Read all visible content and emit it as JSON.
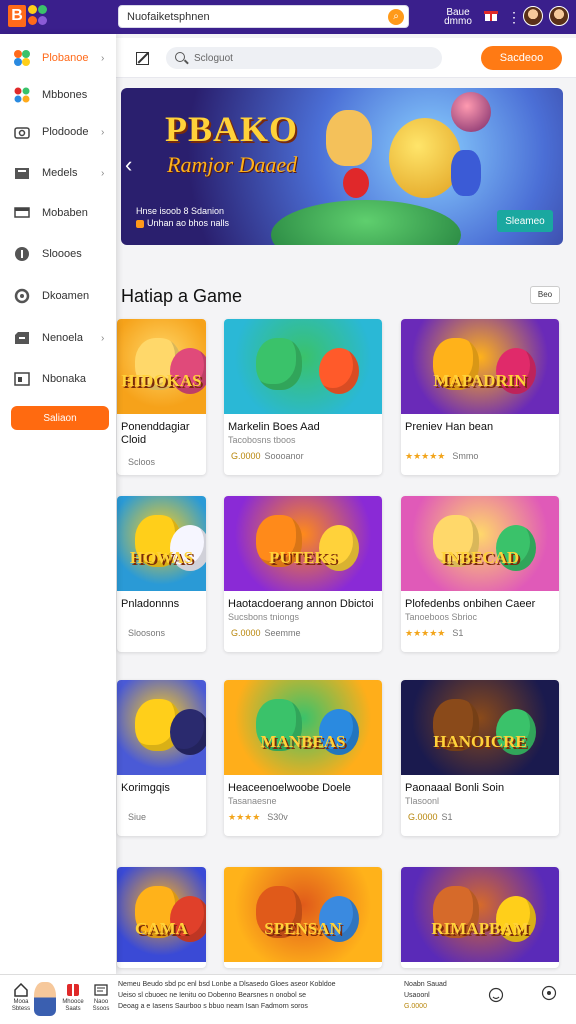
{
  "topbar": {
    "logo_letter": "B",
    "search_value": "Nuofaiketsphnen",
    "label": "Baue dmmo",
    "icons": [
      "gift-icon",
      "more-vertical-icon",
      "avatar",
      "avatar"
    ]
  },
  "sidebar": {
    "items": [
      {
        "label": "Plobanoe",
        "icon": "colorful-blocks-icon",
        "chevron": true,
        "active": true
      },
      {
        "label": "Mbbones",
        "icon": "dots-icon",
        "chevron": false,
        "active": false
      },
      {
        "label": "Plodoode",
        "icon": "camera-icon",
        "chevron": true,
        "active": false
      },
      {
        "label": "Medels",
        "icon": "box-icon",
        "chevron": true,
        "active": false
      },
      {
        "label": "Mobaben",
        "icon": "monitor-icon",
        "chevron": false,
        "active": false
      },
      {
        "label": "Sloooes",
        "icon": "info-icon",
        "chevron": false,
        "active": false
      },
      {
        "label": "Dkoamen",
        "icon": "settings-icon",
        "chevron": false,
        "active": false
      },
      {
        "label": "Nenoela",
        "icon": "store-icon",
        "chevron": true,
        "active": false
      },
      {
        "label": "Nbonaka",
        "icon": "window-icon",
        "chevron": false,
        "active": false
      }
    ],
    "button_label": "Saliaon"
  },
  "subbar": {
    "search_placeholder": "Scloguot",
    "button_label": "Sacdeoo"
  },
  "banner": {
    "title": "PBAKO",
    "subtitle": "Ramjor Daaed",
    "caption1": "Hnse isoob 8 Sdanion",
    "caption2": "Unhan ao bhos nalls",
    "button_label": "Sleameo"
  },
  "section": {
    "title": "Hatiap a Game",
    "select_value": "Beo"
  },
  "cards": [
    {
      "image_text": "HIDOKAS",
      "title": "Ponenddagiar",
      "title2": "Cloid",
      "sub": "",
      "meta_stars": "",
      "meta_price": "",
      "meta_extra": "Scloos"
    },
    {
      "image_text": "",
      "title": "Markelin Boes Aad",
      "title2": "",
      "sub": "Tacobosns tboos",
      "meta_stars": "",
      "meta_price": "G.0000",
      "meta_extra": "Soooanor"
    },
    {
      "image_text": "MAPADRIN",
      "title": "Preniev Han bean",
      "title2": "",
      "sub": "",
      "meta_stars": "★★★★★",
      "meta_price": "",
      "meta_extra": "Smmo"
    },
    {
      "image_text": "HOWAS",
      "title": "Pnladonnns",
      "title2": "",
      "sub": "",
      "meta_stars": "",
      "meta_price": "",
      "meta_extra": "Sloosons"
    },
    {
      "image_text": "PUTEKS",
      "title": "Haotacdoerang annon Dbictoi",
      "title2": "",
      "sub": "Sucsbons tniongs",
      "meta_stars": "",
      "meta_price": "G.0000",
      "meta_extra": "Seemme"
    },
    {
      "image_text": "INBECAD",
      "title": "Plofedenbs onbihen Caeer",
      "title2": "",
      "sub": "Tanoeboos Sbrioc",
      "meta_stars": "★★★★★",
      "meta_price": "",
      "meta_extra": "S1"
    },
    {
      "image_text": "",
      "title": "Korimgqis",
      "title2": "",
      "sub": "",
      "meta_stars": "",
      "meta_price": "",
      "meta_extra": "Siue"
    },
    {
      "image_text": "MANBEAS",
      "title": "Heaceenoelwoobe Doele",
      "title2": "",
      "sub": "Tasanaesne",
      "meta_stars": "★★★★",
      "meta_price": "",
      "meta_extra": "S30v"
    },
    {
      "image_text": "HANOICRE",
      "title": "Paonaaal Bonli Soin",
      "title2": "",
      "sub": "Tlasoonl",
      "meta_stars": "",
      "meta_price": "G.0000",
      "meta_extra": "S1"
    },
    {
      "image_text": "CAMA",
      "title": "",
      "title2": "",
      "sub": "",
      "meta_stars": "",
      "meta_price": "",
      "meta_extra": ""
    },
    {
      "image_text": "SPENSAN",
      "title": "",
      "title2": "",
      "sub": "",
      "meta_stars": "",
      "meta_price": "",
      "meta_extra": ""
    },
    {
      "image_text": "RIMAPBAM",
      "title": "",
      "title2": "",
      "sub": "",
      "meta_stars": "",
      "meta_price": "",
      "meta_extra": ""
    }
  ],
  "bottomnav": {
    "items": [
      {
        "label": "Mooa Sbtess",
        "icon": "home-icon"
      },
      {
        "label": "Mhooce Saats",
        "icon": "gift-icon"
      },
      {
        "label": "Naoo Ssoos",
        "icon": "tag-icon"
      }
    ],
    "text_lines": [
      "Nemeu Beudo  sbd pc enl  bsd   Lonbe a Dlsasedo Gloes aseor Kobldoe",
      "Ueiso  sl cbuoec ne Ienitu oo Dobenno Bearsnes n onobol se",
      "Deoag a e Iasens Saurboo s bbuo neam Isan  Fadmorn  soros"
    ],
    "right_text": [
      "Noabn  Sauad",
      "Usaoonl",
      "G.0000"
    ],
    "right_icons": [
      "face-icon",
      "help-icon"
    ]
  }
}
